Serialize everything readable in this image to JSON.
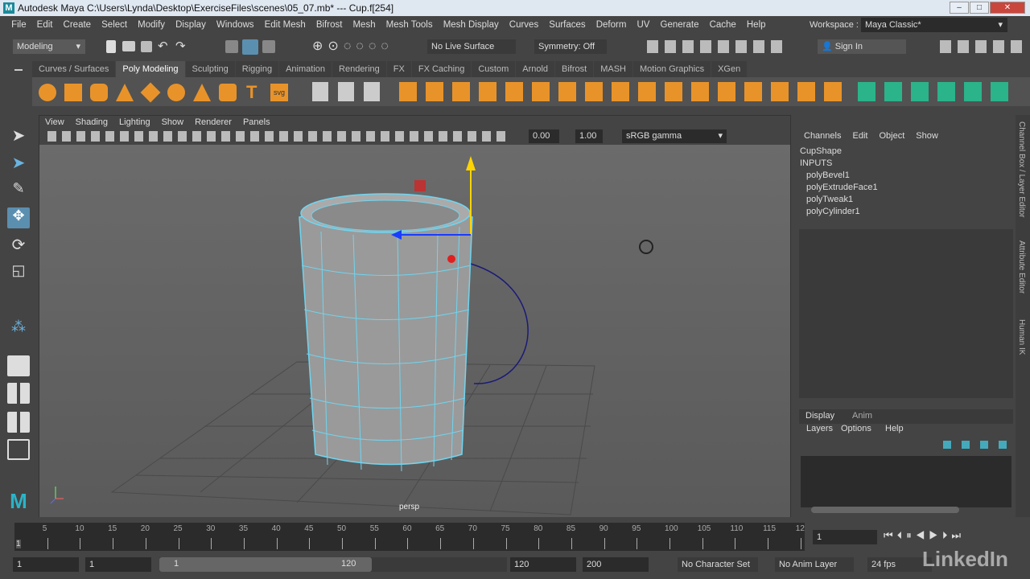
{
  "title": "Autodesk Maya  C:\\Users\\Lynda\\Desktop\\ExerciseFiles\\scenes\\05_07.mb*  ---  Cup.f[254]",
  "menu": [
    "File",
    "Edit",
    "Create",
    "Select",
    "Modify",
    "Display",
    "Windows",
    "Edit Mesh",
    "Bifrost",
    "Mesh",
    "Mesh Tools",
    "Mesh Display",
    "Curves",
    "Surfaces",
    "Deform",
    "UV",
    "Generate",
    "Cache",
    "Help"
  ],
  "workspace": {
    "label": "Workspace :",
    "value": "Maya Classic*"
  },
  "status": {
    "menuset": "Modeling",
    "live_surface": "No Live Surface",
    "symmetry": "Symmetry: Off",
    "sign_in": "Sign In"
  },
  "shelf_tabs": [
    "Curves / Surfaces",
    "Poly Modeling",
    "Sculpting",
    "Rigging",
    "Animation",
    "Rendering",
    "FX",
    "FX Caching",
    "Custom",
    "Arnold",
    "Bifrost",
    "MASH",
    "Motion Graphics",
    "XGen"
  ],
  "shelf_active": "Poly Modeling",
  "panel_menu": [
    "View",
    "Shading",
    "Lighting",
    "Show",
    "Renderer",
    "Panels"
  ],
  "panel_fields": {
    "exposure": "0.00",
    "gamma": "1.00",
    "colorspace": "sRGB gamma"
  },
  "camera_label": "persp",
  "channel_box": {
    "menu": [
      "Channels",
      "Edit",
      "Object",
      "Show"
    ],
    "shape": "CupShape",
    "inputs_label": "INPUTS",
    "inputs": [
      "polyBevel1",
      "polyExtrudeFace1",
      "polyTweak1",
      "polyCylinder1"
    ]
  },
  "layer_editor": {
    "tabs": [
      "Display",
      "Anim"
    ],
    "menu": [
      "Layers",
      "Options",
      "Help"
    ]
  },
  "side_tabs": [
    "Channel Box / Layer Editor",
    "Attribute Editor",
    "Human IK"
  ],
  "timeline": {
    "ticks": [
      "5",
      "10",
      "15",
      "20",
      "25",
      "30",
      "35",
      "40",
      "45",
      "50",
      "55",
      "60",
      "65",
      "70",
      "75",
      "80",
      "85",
      "90",
      "95",
      "100",
      "105",
      "110",
      "115",
      "12"
    ],
    "current": "1",
    "current_frame_field": "1"
  },
  "range": {
    "start": "1",
    "playback_start": "1",
    "slider_start": "1",
    "slider_end": "120",
    "playback_end": "120",
    "end": "200",
    "character_set": "No Character Set",
    "anim_layer": "No Anim Layer",
    "fps": "24 fps"
  },
  "watermark": "LinkedIn"
}
